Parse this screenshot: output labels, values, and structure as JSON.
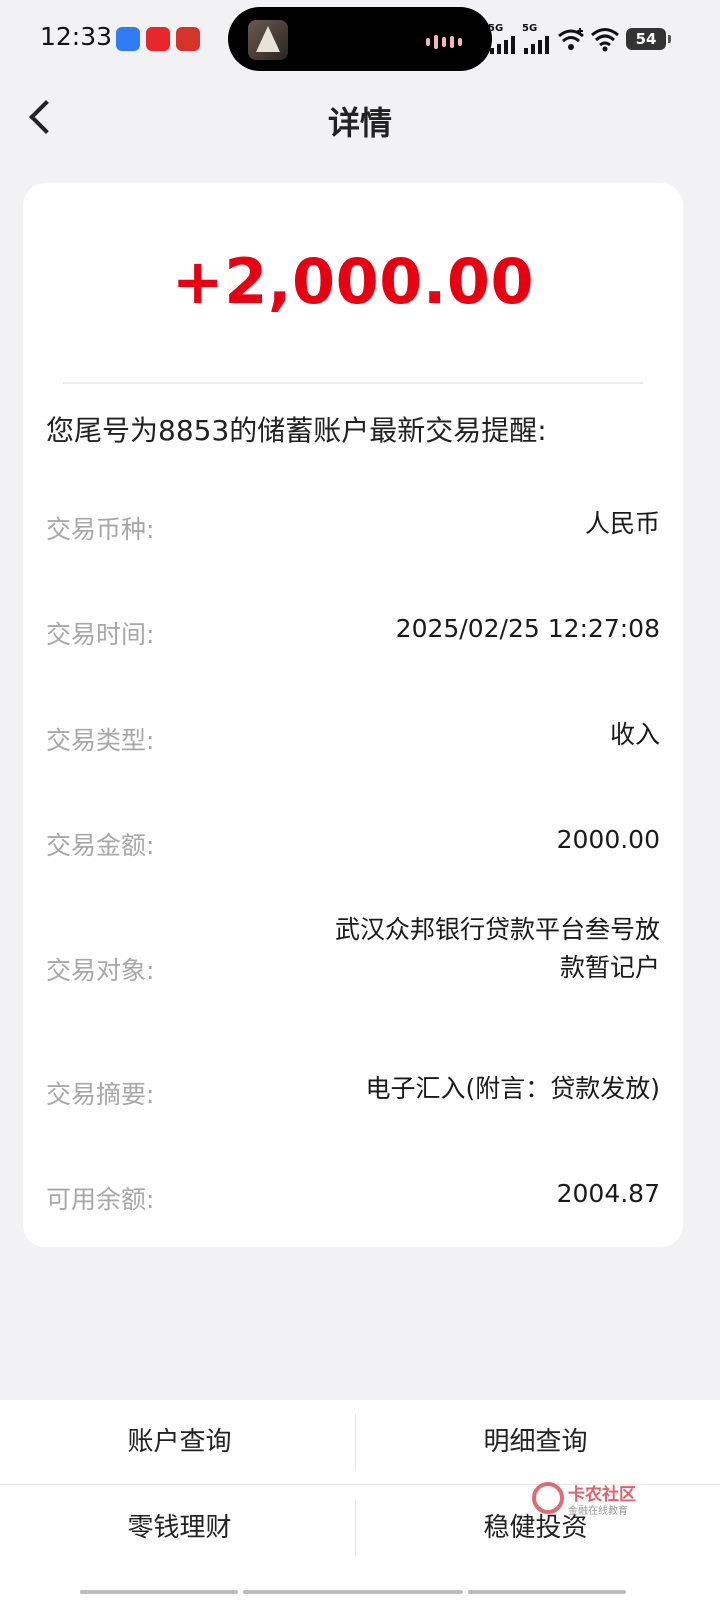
{
  "status_bar": {
    "time": "12:33",
    "network_1": "5G",
    "network_2": "5G",
    "battery": "54"
  },
  "nav": {
    "title": "详情"
  },
  "transaction": {
    "amount": "+2,000.00",
    "amount_color": "#e60012",
    "notice": "您尾号为8853的储蓄账户最新交易提醒:",
    "rows": [
      {
        "label": "交易币种:",
        "value": "人民币"
      },
      {
        "label": "交易时间:",
        "value": "2025/02/25 12:27:08"
      },
      {
        "label": "交易类型:",
        "value": "收入"
      },
      {
        "label": "交易金额:",
        "value": "2000.00"
      },
      {
        "label": "交易对象:",
        "value": "武汉众邦银行贷款平台叁号放\n款暂记户"
      },
      {
        "label": "交易摘要:",
        "value": "电子汇入(附言：贷款发放)"
      },
      {
        "label": "可用余额:",
        "value": "2004.87"
      }
    ]
  },
  "bottom_menu": {
    "account_query": "账户查询",
    "detail_query": "明细查询",
    "wealth": "零钱理财",
    "invest": "稳健投资"
  },
  "watermark": {
    "title": "卡农社区",
    "subtitle": "金融在线教育"
  }
}
